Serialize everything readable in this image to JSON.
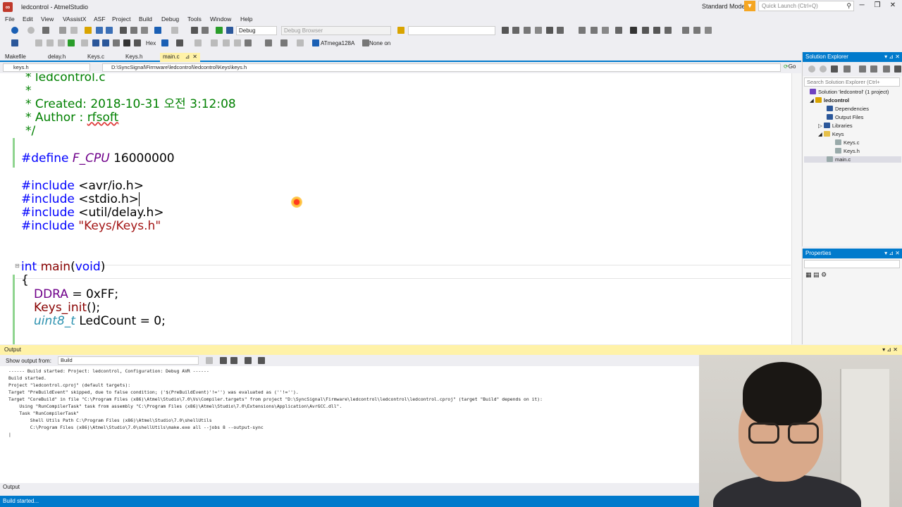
{
  "window": {
    "title": "ledcontrol - AtmelStudio",
    "mode": "Standard Mode",
    "quick_launch_placeholder": "Quick Launch (Ctrl+Q)"
  },
  "menu": [
    "File",
    "Edit",
    "View",
    "VAssistX",
    "ASF",
    "Project",
    "Build",
    "Debug",
    "Tools",
    "Window",
    "Help"
  ],
  "toolbar": {
    "config": "Debug",
    "debug_browser": "Debug Browser",
    "hex": "Hex",
    "device": "ATmega128A",
    "tool": "None on"
  },
  "tabs": [
    {
      "label": "Makefile"
    },
    {
      "label": "delay.h"
    },
    {
      "label": "Keys.c"
    },
    {
      "label": "Keys.h"
    },
    {
      "label": "main.c",
      "active": true
    }
  ],
  "navbar": {
    "scope": "keys.h",
    "scope_prefix": "h",
    "path": "D:\\SyncSignal\\Firmware\\ledcontrol\\ledcontrol\\Keys\\keys.h",
    "go": "Go"
  },
  "code": {
    "l1": "* ledcontrol.c",
    "l2": "*",
    "l3": "* Created: 2018-10-31 오전 3:12:08",
    "l4a": "* Author : ",
    "l4b": "rfsoft",
    "l5": "*/",
    "define_kw": "#define",
    "define_name": "F_CPU",
    "define_val": " 16000000",
    "inc_kw": "#include",
    "inc1": " <avr/io.h>",
    "inc2": " <stdio.h>",
    "inc3": " <util/delay.h>",
    "inc4": "\"Keys/Keys.h\"",
    "main_int": "int",
    "main_name": " main",
    "main_args": "(",
    "main_void": "void",
    "main_close": ")",
    "brace": "{",
    "ddra": "DDRA",
    "ddra_rest": " = 0xFF;",
    "keys_init": "Keys_init",
    "keys_init_rest": "();",
    "uint_type": "uint8_t",
    "led_rest": " LedCount = 0;"
  },
  "solution": {
    "title": "Solution Explorer",
    "search_placeholder": "Search Solution Explorer (Ctrl+",
    "items": [
      {
        "label": "Solution 'ledcontrol' (1 project)"
      },
      {
        "label": "ledcontrol"
      },
      {
        "label": "Dependencies"
      },
      {
        "label": "Output Files"
      },
      {
        "label": "Libraries"
      },
      {
        "label": "Keys"
      },
      {
        "label": "Keys.c"
      },
      {
        "label": "Keys.h"
      },
      {
        "label": "main.c"
      }
    ]
  },
  "properties": {
    "title": "Properties"
  },
  "output": {
    "title": "Output",
    "show_from_label": "Show output from:",
    "show_from_value": "Build",
    "lines": [
      "------ Build started: Project: ledcontrol, Configuration: Debug AVR ------",
      "Build started.",
      "Project \"ledcontrol.cproj\" (default targets):",
      "Target \"PreBuildEvent\" skipped, due to false condition; ('$(PreBuildEvent)'!='') was evaluated as (''!='').",
      "Target \"CoreBuild\" in file \"C:\\Program Files (x86)\\Atmel\\Studio\\7.0\\Vs\\Compiler.targets\" from project \"D:\\SyncSignal\\Firmware\\ledcontrol\\ledcontrol\\ledcontrol.cproj\" (target \"Build\" depends on it):",
      "    Using \"RunCompilerTask\" task from assembly \"C:\\Program Files (x86)\\Atmel\\Studio\\7.0\\Extensions\\Application\\AvrGCC.dll\".",
      "    Task \"RunCompilerTask\"",
      "        Shell Utils Path C:\\Program Files (x86)\\Atmel\\Studio\\7.0\\shellUtils",
      "        C:\\Program Files (x86)\\Atmel\\Studio\\7.0\\shellUtils\\make.exe all --jobs 8 --output-sync",
      "|"
    ],
    "tab": "Output"
  },
  "status": {
    "text": "Build started..."
  },
  "colors": {
    "accent": "#007acc",
    "active_tab": "#fff2a8"
  }
}
